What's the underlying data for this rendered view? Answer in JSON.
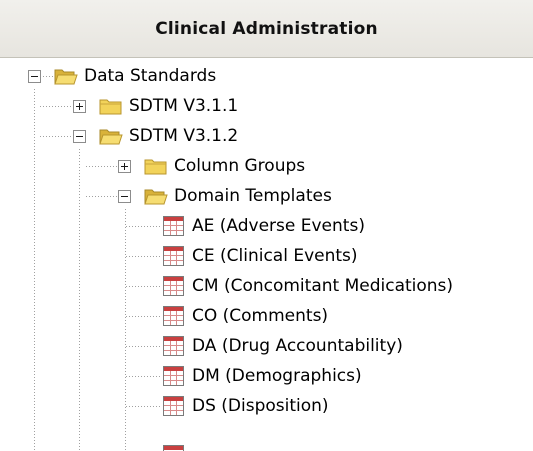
{
  "header": {
    "title": "Clinical Administration"
  },
  "tree": {
    "root": {
      "label": "Data Standards",
      "expanded": true,
      "icon": "folder-open-icon"
    },
    "sdtm_311": {
      "label": "SDTM V3.1.1",
      "expanded": false,
      "icon": "folder-closed-icon"
    },
    "sdtm_312": {
      "label": "SDTM V3.1.2",
      "expanded": true,
      "icon": "folder-open-icon"
    },
    "column_groups": {
      "label": "Column Groups",
      "expanded": false,
      "icon": "folder-closed-icon"
    },
    "domain_templates": {
      "label": "Domain Templates",
      "expanded": true,
      "icon": "folder-open-icon"
    },
    "templates": [
      {
        "label": "AE (Adverse Events)",
        "icon": "table-icon"
      },
      {
        "label": "CE (Clinical Events)",
        "icon": "table-icon"
      },
      {
        "label": "CM (Concomitant Medications)",
        "icon": "table-icon"
      },
      {
        "label": "CO (Comments)",
        "icon": "table-icon"
      },
      {
        "label": "DA (Drug Accountability)",
        "icon": "table-icon"
      },
      {
        "label": "DM (Demographics)",
        "icon": "table-icon"
      },
      {
        "label": "DS (Disposition)",
        "icon": "table-icon"
      }
    ]
  },
  "colors": {
    "tree_line": "#a0a0a0",
    "folder": "#f2d35a",
    "table_header": "#c94040"
  }
}
